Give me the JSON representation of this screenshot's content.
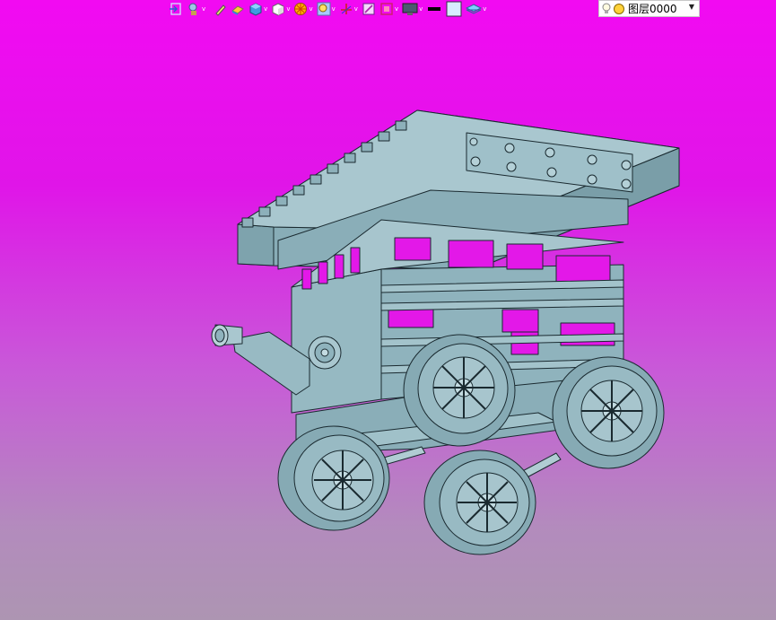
{
  "toolbar": {
    "layer_select": {
      "value": "图层0000"
    },
    "buttons": [
      {
        "icon": "insert-icon"
      },
      {
        "icon": "search-icon"
      },
      {
        "icon": "pencil-icon"
      },
      {
        "icon": "eraser-icon"
      },
      {
        "icon": "box-icon"
      },
      {
        "icon": "cube-icon"
      },
      {
        "icon": "render-wheel-icon"
      },
      {
        "icon": "zoom-icon"
      },
      {
        "icon": "axis-icon"
      },
      {
        "icon": "section-icon"
      },
      {
        "icon": "view-frame-icon"
      },
      {
        "icon": "monitor-icon"
      },
      {
        "icon": "line-weight-icon"
      },
      {
        "icon": "color-swatch-icon"
      },
      {
        "icon": "layers-icon"
      }
    ]
  },
  "colors": {
    "background_top": "#f20af2",
    "background_bottom": "#ad95b2",
    "model_fill": "#8fb3bd",
    "model_edge": "#1a2a30",
    "layer_bulb": "#ffd23a"
  }
}
